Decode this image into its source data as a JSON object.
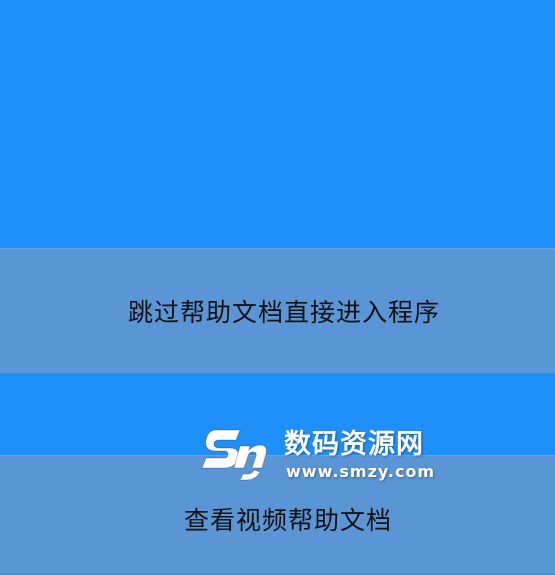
{
  "buttons": {
    "skip_label": "跳过帮助文档直接进入程序",
    "video_label": "查看视频帮助文档"
  },
  "watermark": {
    "title": "数码资源网",
    "url": "www.smzy.com"
  },
  "colors": {
    "background": "#1e8ff9",
    "button": "#5a95d6",
    "text": "#111111"
  }
}
